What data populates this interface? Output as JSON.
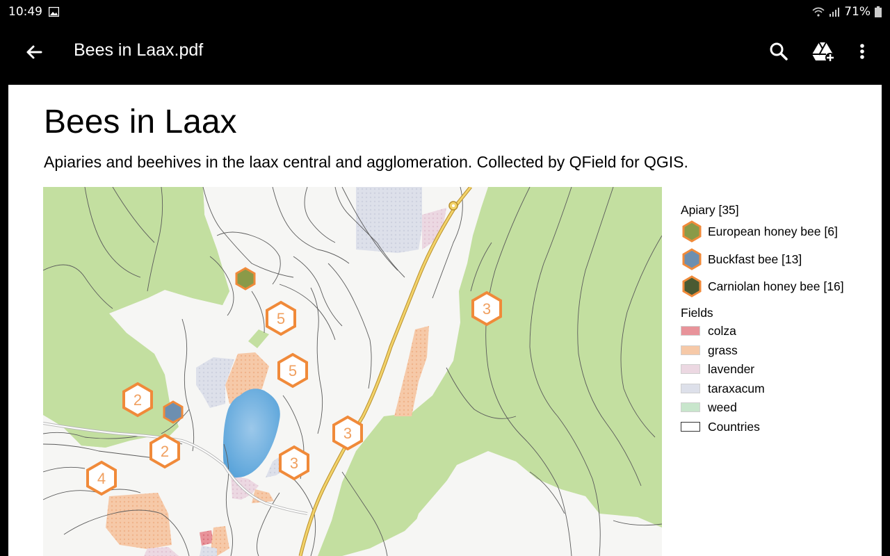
{
  "status": {
    "time": "10:49",
    "battery": "71%"
  },
  "appbar": {
    "title": "Bees in Laax.pdf"
  },
  "document": {
    "title": "Bees in Laax",
    "subtitle": "Apiaries and beehives in the laax central and agglomeration. Collected by QField for QGIS."
  },
  "map": {
    "cluster_counts": [
      "5",
      "5",
      "2",
      "2",
      "4",
      "3",
      "3",
      "3"
    ]
  },
  "legend": {
    "apiary_heading": "Apiary [35]",
    "apiary_items": [
      {
        "label": "European honey bee [6]",
        "color": "#8a9a48"
      },
      {
        "label": "Buckfast bee [13]",
        "color": "#6d8fb0"
      },
      {
        "label": "Carniolan honey bee [16]",
        "color": "#4a5a32"
      }
    ],
    "fields_heading": "Fields",
    "field_items": [
      {
        "label": "colza",
        "color": "#e8939a"
      },
      {
        "label": "grass",
        "color": "#f6c9a8"
      },
      {
        "label": "lavender",
        "color": "#ecd8e2"
      },
      {
        "label": "taraxacum",
        "color": "#dde0ea"
      },
      {
        "label": "weed",
        "color": "#c8e6cc"
      },
      {
        "label": "Countries",
        "color": "#ffffff"
      }
    ]
  },
  "colors": {
    "forest": "#c3dfa0",
    "lake": "#7ab6e2",
    "road": "#e8c45a",
    "marker_stroke": "#f08a3a"
  }
}
